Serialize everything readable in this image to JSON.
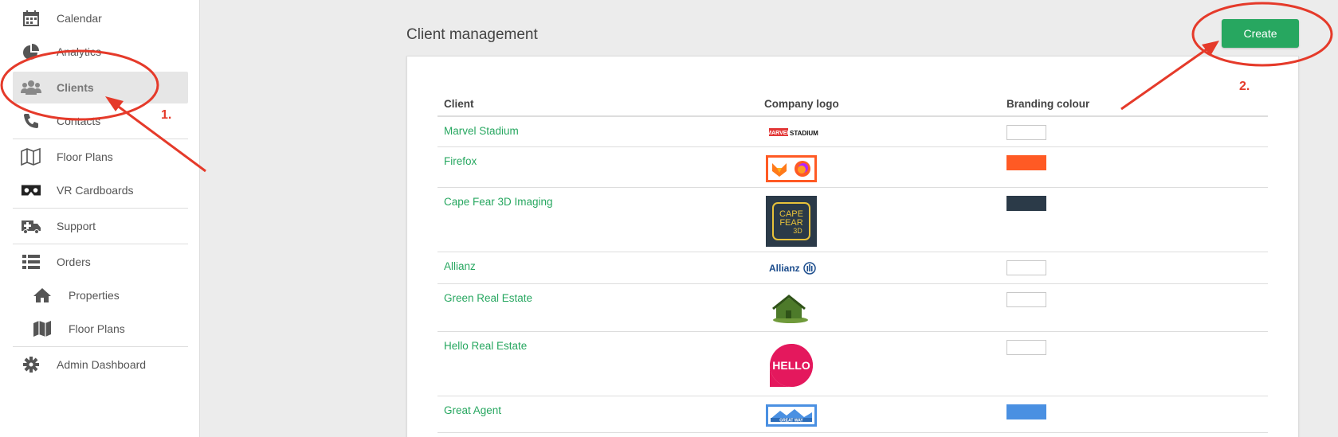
{
  "sidebar": {
    "items": [
      {
        "label": "Calendar"
      },
      {
        "label": "Analytics"
      },
      {
        "label": "Clients"
      },
      {
        "label": "Contacts"
      },
      {
        "label": "Floor Plans"
      },
      {
        "label": "VR Cardboards"
      },
      {
        "label": "Support"
      },
      {
        "label": "Orders"
      },
      {
        "label": "Properties"
      },
      {
        "label": "Floor Plans"
      },
      {
        "label": "Admin Dashboard"
      }
    ]
  },
  "main": {
    "title": "Client management",
    "create_label": "Create",
    "columns": [
      "Client",
      "Company logo",
      "Branding colour"
    ],
    "rows": [
      {
        "client": "Marvel Stadium",
        "logo": "marvel-stadium-logo",
        "colour": "#ffffff"
      },
      {
        "client": "Firefox",
        "logo": "firefox-logo",
        "colour": "#ff5a24"
      },
      {
        "client": "Cape Fear 3D Imaging",
        "logo": "cape-fear-logo",
        "colour": "#2b3a48"
      },
      {
        "client": "Allianz",
        "logo": "allianz-logo",
        "colour": "#ffffff"
      },
      {
        "client": "Green Real Estate",
        "logo": "green-house-logo",
        "colour": "#ffffff"
      },
      {
        "client": "Hello Real Estate",
        "logo": "hello-logo",
        "colour": "#ffffff"
      },
      {
        "client": "Great Agent",
        "logo": "great-way-logo",
        "colour": "#4a90e2"
      }
    ]
  },
  "annotations": {
    "step1": "1.",
    "step2": "2."
  },
  "colors": {
    "accent": "#27a760",
    "annotation": "#e53a2a"
  }
}
